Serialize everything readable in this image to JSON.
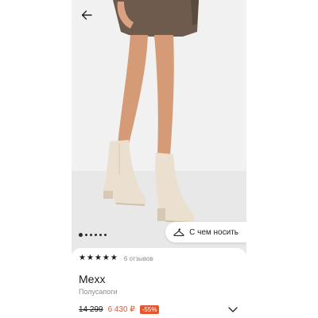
{
  "product": {
    "brand": "Mexx",
    "category": "Полусапоги",
    "rating_stars": 5,
    "reviews": "6 отзывов",
    "price_old": "14 299",
    "price_new": "6 430 ₽",
    "discount": "-55%"
  },
  "gallery": {
    "wear_with_label": "С чем носить",
    "dot_count": 6,
    "active_dot": 0
  },
  "icons": {
    "back": "arrow-left-icon",
    "hanger": "hanger-icon",
    "chevron": "chevron-down-icon",
    "star": "star-icon"
  },
  "colors": {
    "discount": "#e4572e",
    "boot": "#e9ddcd"
  }
}
